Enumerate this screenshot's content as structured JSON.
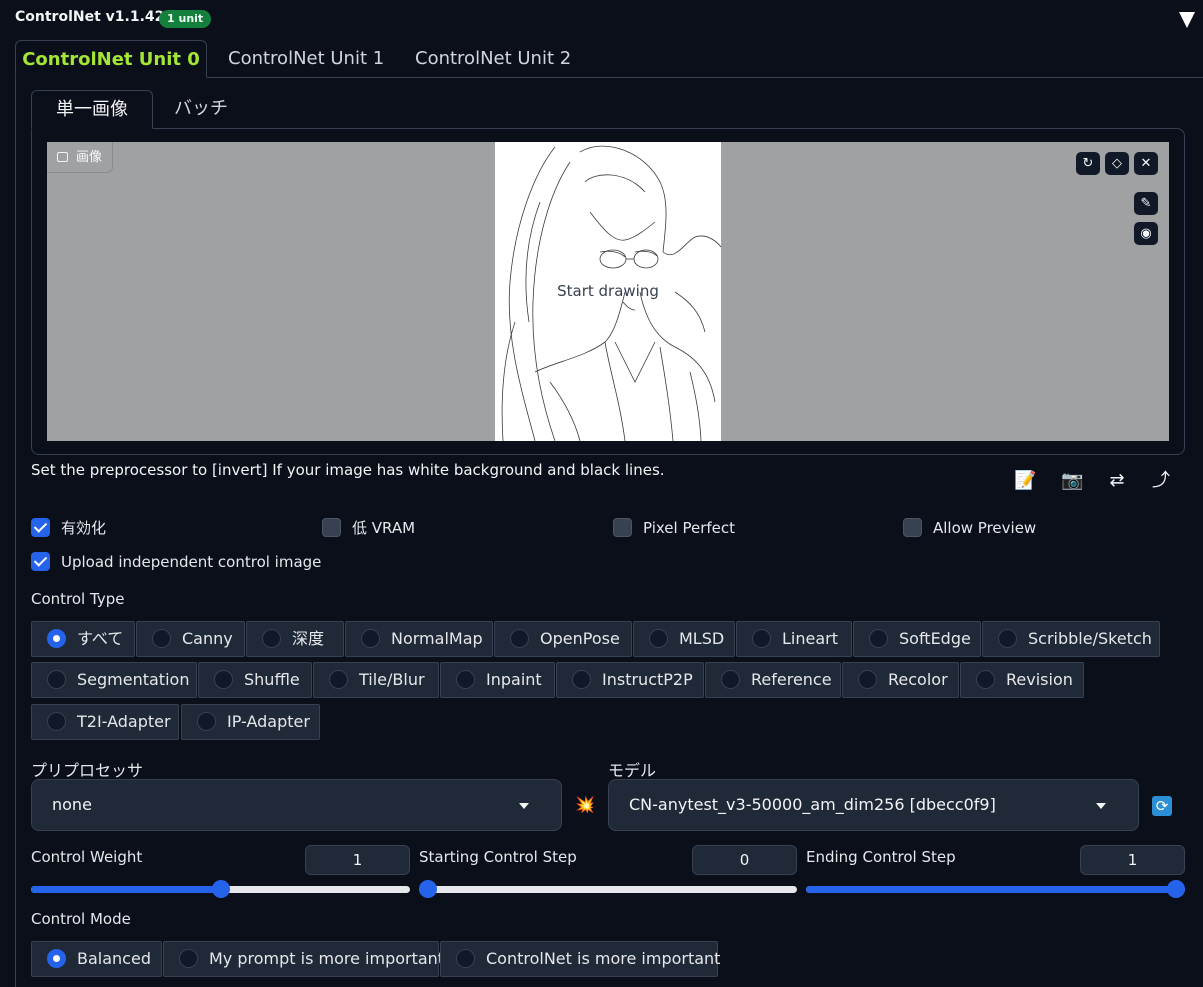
{
  "header": {
    "title": "ControlNet v1.1.422",
    "badge": "1 unit"
  },
  "unit_tabs": [
    "ControlNet Unit 0",
    "ControlNet Unit 1",
    "ControlNet Unit 2"
  ],
  "image_tabs": [
    "単一画像",
    "バッチ"
  ],
  "canvas": {
    "label": "画像",
    "placeholder": "Start drawing"
  },
  "hint": "Set the preprocessor to [invert] If your image has white background and black lines.",
  "checkboxes": {
    "enable": {
      "label": "有効化",
      "checked": true
    },
    "low_vram": {
      "label": "低 VRAM",
      "checked": false
    },
    "pixel_perfect": {
      "label": "Pixel Perfect",
      "checked": false
    },
    "allow_preview": {
      "label": "Allow Preview",
      "checked": false
    },
    "upload_independent": {
      "label": "Upload independent control image",
      "checked": true
    }
  },
  "control_type": {
    "label": "Control Type",
    "options": [
      "すべて",
      "Canny",
      "深度",
      "NormalMap",
      "OpenPose",
      "MLSD",
      "Lineart",
      "SoftEdge",
      "Scribble/Sketch",
      "Segmentation",
      "Shuffle",
      "Tile/Blur",
      "Inpaint",
      "InstructP2P",
      "Reference",
      "Recolor",
      "Revision",
      "T2I-Adapter",
      "IP-Adapter"
    ],
    "selected": "すべて"
  },
  "preprocessor": {
    "label": "プリプロセッサ",
    "value": "none"
  },
  "model": {
    "label": "モデル",
    "value": "CN-anytest_v3-50000_am_dim256 [dbecc0f9]"
  },
  "sliders": {
    "control_weight": {
      "label": "Control Weight",
      "value": "1",
      "fraction": 0.5
    },
    "starting_step": {
      "label": "Starting Control Step",
      "value": "0",
      "fraction": 0.0
    },
    "ending_step": {
      "label": "Ending Control Step",
      "value": "1",
      "fraction": 1.0
    }
  },
  "control_mode": {
    "label": "Control Mode",
    "options": [
      "Balanced",
      "My prompt is more important",
      "ControlNet is more important"
    ],
    "selected": "Balanced"
  },
  "icons": {
    "undo": "↻",
    "eraser": "◇",
    "close": "✕",
    "brush": "✎",
    "palette": "◉",
    "memo": "📝",
    "camera": "📷",
    "swap": "⇄",
    "send": "⤴",
    "explode": "💥",
    "refresh": "⟳"
  }
}
